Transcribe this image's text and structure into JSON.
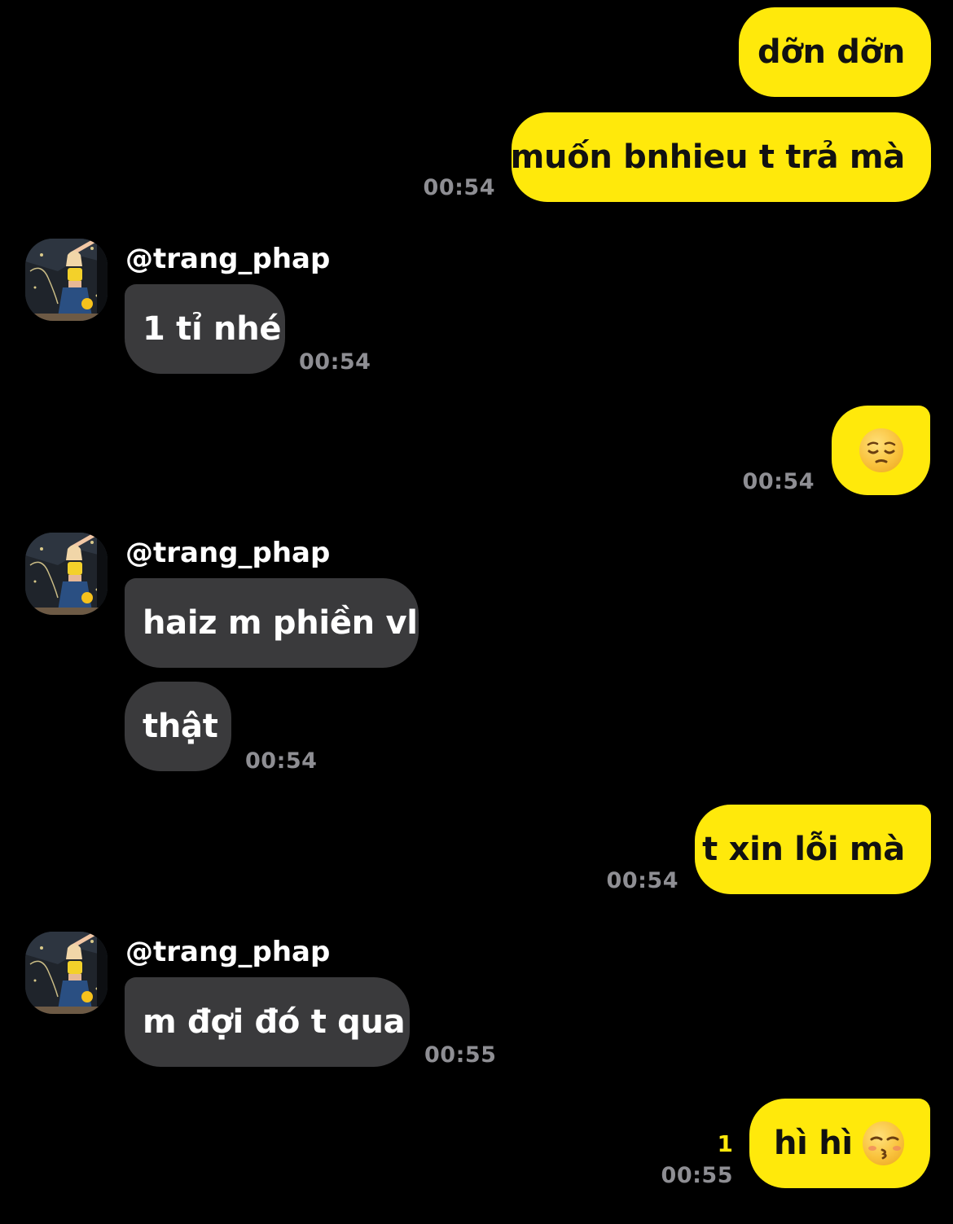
{
  "chat": {
    "sender_name": "@trang_phap",
    "colors": {
      "background": "#000000",
      "outgoing_bubble": "#FFE90B",
      "incoming_bubble": "#3A3A3C",
      "timestamp": "#8E8E93",
      "unread": "#FFE90B"
    },
    "messages": [
      {
        "from": "me",
        "text": "dỡn dỡn"
      },
      {
        "from": "me",
        "text": "muốn bnhieu t trả mà",
        "time": "00:54"
      },
      {
        "from": "them",
        "text": "1 tỉ nhé",
        "time": "00:54"
      },
      {
        "from": "me",
        "emoji": "pensive-face-emoji",
        "time": "00:54"
      },
      {
        "from": "them",
        "text": "haiz m phiền vl"
      },
      {
        "from": "them",
        "text": "thật",
        "time": "00:54"
      },
      {
        "from": "me",
        "text": "t xin lỗi mà",
        "time": "00:54"
      },
      {
        "from": "them",
        "text": "m đợi đó t qua",
        "time": "00:55"
      },
      {
        "from": "me",
        "text": "hì hì",
        "emoji": "kissing-face-with-closed-eyes-emoji",
        "time": "00:55",
        "unread": "1"
      }
    ]
  }
}
